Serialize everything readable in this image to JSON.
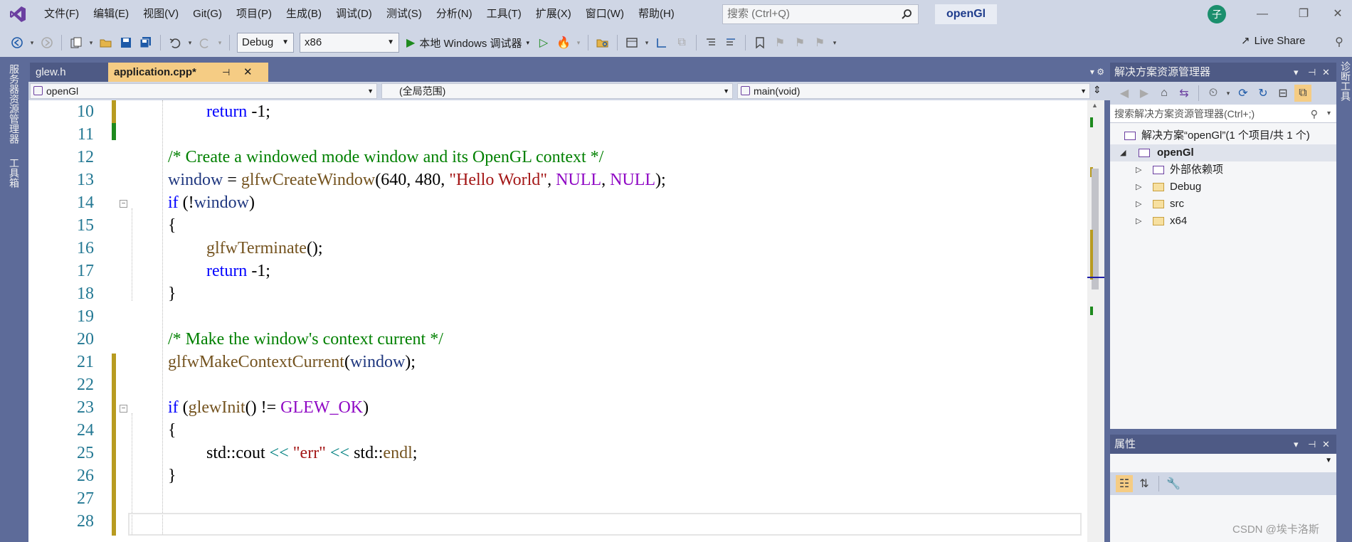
{
  "menu": {
    "items": [
      "文件(F)",
      "编辑(E)",
      "视图(V)",
      "Git(G)",
      "项目(P)",
      "生成(B)",
      "调试(D)",
      "测试(S)",
      "分析(N)",
      "工具(T)",
      "扩展(X)",
      "窗口(W)",
      "帮助(H)"
    ],
    "search_placeholder": "搜索 (Ctrl+Q)",
    "solution_name": "openGl",
    "avatar_letter": "子"
  },
  "toolbar": {
    "config": "Debug",
    "platform": "x86",
    "run_label": "本地 Windows 调试器",
    "live_share": "Live Share"
  },
  "left_strip": {
    "server_explorer": "服务器资源管理器",
    "toolbox": "工具箱"
  },
  "right_strip": {
    "diagnostic_tools": "诊断工具"
  },
  "tabs": [
    {
      "label": "glew.h",
      "active": false
    },
    {
      "label": "application.cpp*",
      "active": true
    }
  ],
  "navbar": {
    "project": "openGl",
    "scope": "(全局范围)",
    "member": "main(void)"
  },
  "editor": {
    "line_numbers": [
      "10",
      "11",
      "12",
      "13",
      "14",
      "15",
      "16",
      "17",
      "18",
      "19",
      "20",
      "21",
      "22",
      "23",
      "24",
      "25",
      "26",
      "27",
      "28"
    ],
    "code": {
      "l10_kw": "return",
      "l10_rest": " -1;",
      "l12": "/* Create a windowed mode window and its OpenGL context */",
      "l13_var": "window",
      "l13_eq": " = ",
      "l13_fn": "glfwCreateWindow",
      "l13_args": "(640, 480, ",
      "l13_str": "\"Hello World\"",
      "l13_comma": ", ",
      "l13_null1": "NULL",
      "l13_comma2": ", ",
      "l13_null2": "NULL",
      "l13_end": ");",
      "l14_kw": "if",
      "l14_open": " (!",
      "l14_var": "window",
      "l14_close": ")",
      "l15": "{",
      "l16_fn": "glfwTerminate",
      "l16_rest": "();",
      "l17_kw": "return",
      "l17_rest": " -1;",
      "l18": "}",
      "l20": "/* Make the window's context current */",
      "l21_fn": "glfwMakeContextCurrent",
      "l21_open": "(",
      "l21_var": "window",
      "l21_close": ");",
      "l23_kw": "if",
      "l23_open": " (",
      "l23_fn": "glewInit",
      "l23_mid": "() != ",
      "l23_mac": "GLEW_OK",
      "l23_close": ")",
      "l24": "{",
      "l25_ns": "std",
      "l25_sep1": "::cout ",
      "l25_op1": "<<",
      "l25_sp": " ",
      "l25_str": "\"err\"",
      "l25_sp2": " ",
      "l25_op2": "<<",
      "l25_ns2": " std",
      "l25_sep2": "::",
      "l25_fn": "endl",
      "l25_end": ";",
      "l26": "}"
    }
  },
  "solution_explorer": {
    "title": "解决方案资源管理器",
    "search_placeholder": "搜索解决方案资源管理器(Ctrl+;)",
    "solution_label": "解决方案“openGl”(1 个项目/共 1 个)",
    "project": "openGl",
    "items": [
      "外部依赖项",
      "Debug",
      "src",
      "x64"
    ]
  },
  "properties": {
    "title": "属性"
  },
  "watermark": "CSDN @埃卡洛斯",
  "colors": {
    "accent": "#1e3c8c",
    "tab_active": "#f5cc84",
    "panel_header": "#4e5a85",
    "chrome": "#cfd6e5",
    "changed_bar_saved": "#1e8a1e",
    "changed_bar_unsaved": "#b89b20"
  }
}
